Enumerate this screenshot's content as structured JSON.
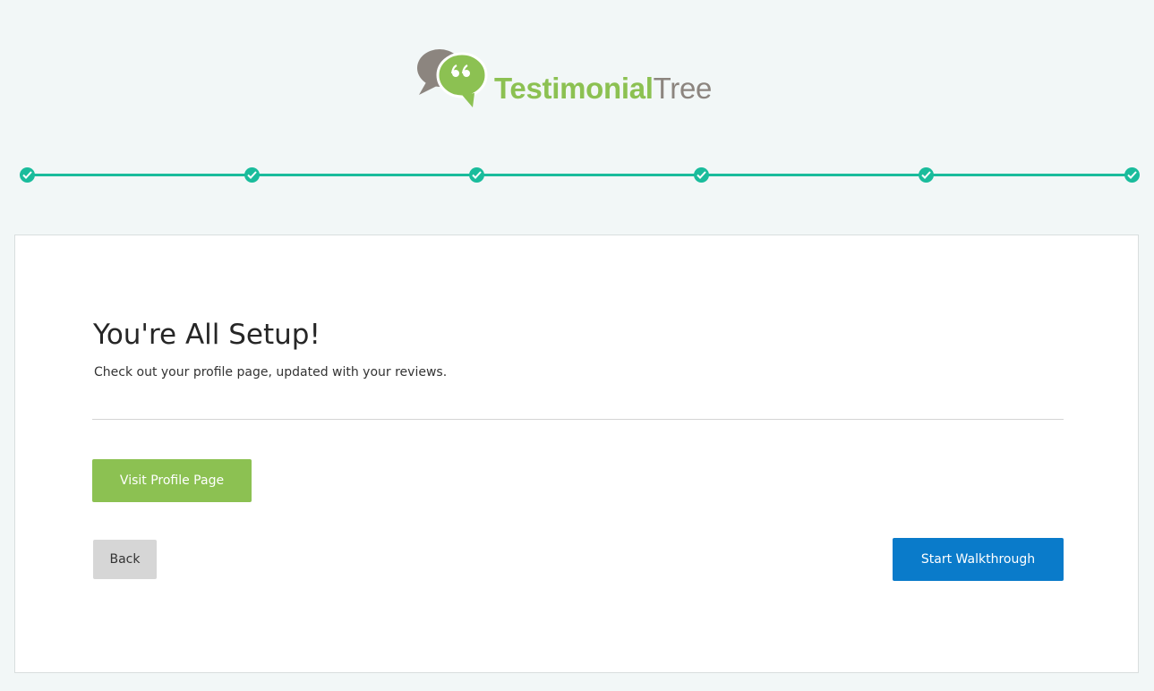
{
  "brand": {
    "name_bold": "Testimonial",
    "name_light": "Tree",
    "colors": {
      "green": "#8cc152",
      "gray": "#8c857f",
      "teal": "#1abc9c"
    },
    "logo_icon": "speech-bubble-quote-icon"
  },
  "progress": {
    "total_steps": 6,
    "completed_steps": 6,
    "step_icon": "check-icon"
  },
  "card": {
    "title": "You're All Setup!",
    "subtitle": "Check out your profile page, updated with your reviews."
  },
  "buttons": {
    "visit_profile": "Visit Profile Page",
    "back": "Back",
    "start_walkthrough": "Start Walkthrough"
  },
  "colors": {
    "page_background": "#f2f7f7",
    "primary_button": "#0a7bca",
    "secondary_button": "#d6d6d6"
  }
}
